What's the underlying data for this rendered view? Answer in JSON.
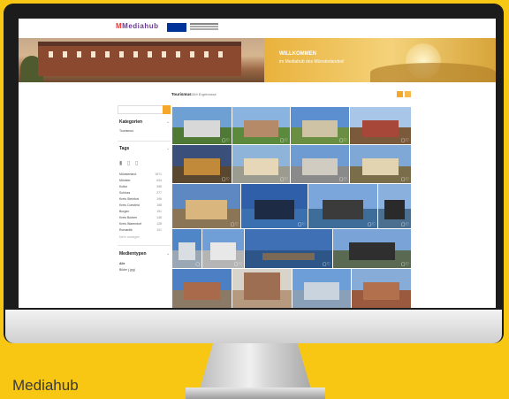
{
  "caption": "Mediahub",
  "header": {
    "logo_text": "Mediahub",
    "welcome_title": "WILLKOMMEN",
    "welcome_subtitle": "im Mediahub des Münsterlandes!"
  },
  "content": {
    "title": "Tourismus",
    "count": "369 Ergebnisse"
  },
  "sidebar": {
    "search_placeholder": "",
    "categories_title": "Kategorien",
    "categories": [
      "Tourismus"
    ],
    "tags_title": "Tags",
    "tags": [
      {
        "label": "Münsterland",
        "count": "1571"
      },
      {
        "label": "Münster",
        "count": "634"
      },
      {
        "label": "Kultur",
        "count": "398"
      },
      {
        "label": "Schloss",
        "count": "277"
      },
      {
        "label": "Kreis Steinfurt",
        "count": "196"
      },
      {
        "label": "Kreis Coesfeld",
        "count": "168"
      },
      {
        "label": "Burgen",
        "count": "151"
      },
      {
        "label": "Kreis Borken",
        "count": "146"
      },
      {
        "label": "Kreis Warendorf",
        "count": "128"
      },
      {
        "label": "Romantik",
        "count": "101"
      }
    ],
    "more_tags": "Mehr anzeigen",
    "media_title": "Medientypen",
    "media_types": [
      "Alle",
      "Bilder (.jpg)"
    ]
  },
  "colors": {
    "background": "#f7c714",
    "accent": "#f4a72a",
    "monitor": "#1c1c1c"
  },
  "icons": [
    "cart-icon",
    "heart-icon",
    "chevron-down-icon",
    "grid-icon",
    "list-icon",
    "search-icon"
  ]
}
